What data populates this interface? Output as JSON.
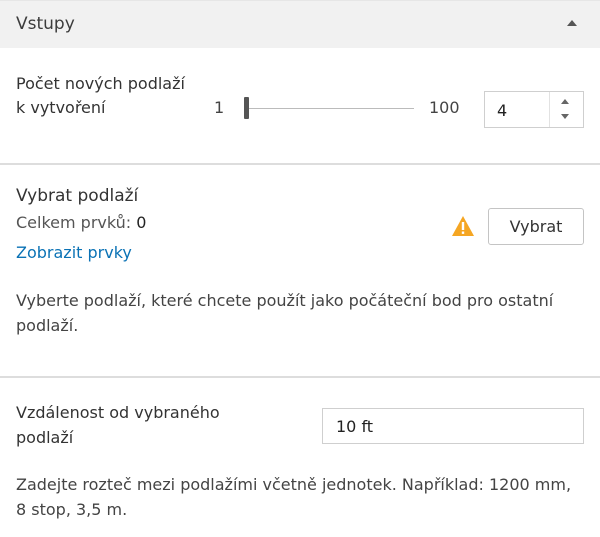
{
  "header": {
    "title": "Vstupy",
    "collapse_icon": "chevron-up-icon"
  },
  "floors_count": {
    "label": "Počet nových podlaží k vytvoření",
    "slider_min": "1",
    "slider_max": "100",
    "value": "4"
  },
  "select_floor": {
    "title": "Vybrat podlaží",
    "count_label": "Celkem prvků:",
    "count_value": "0",
    "show_link": "Zobrazit prvky",
    "button_label": "Vybrat",
    "warning_icon": "warning-icon",
    "warning_color": "#f5a623",
    "hint": "Vyberte podlaží, které chcete použít jako počáteční bod pro ostatní podlaží."
  },
  "distance": {
    "label": "Vzdálenost od vybraného podlaží",
    "value": "10 ft",
    "hint": "Zadejte rozteč mezi podlažími včetně jednotek. Například: 1200 mm, 8 stop, 3,5 m."
  },
  "colors": {
    "link": "#0a72b5",
    "header_bg": "#f1f1f1",
    "divider": "#dddddd"
  }
}
